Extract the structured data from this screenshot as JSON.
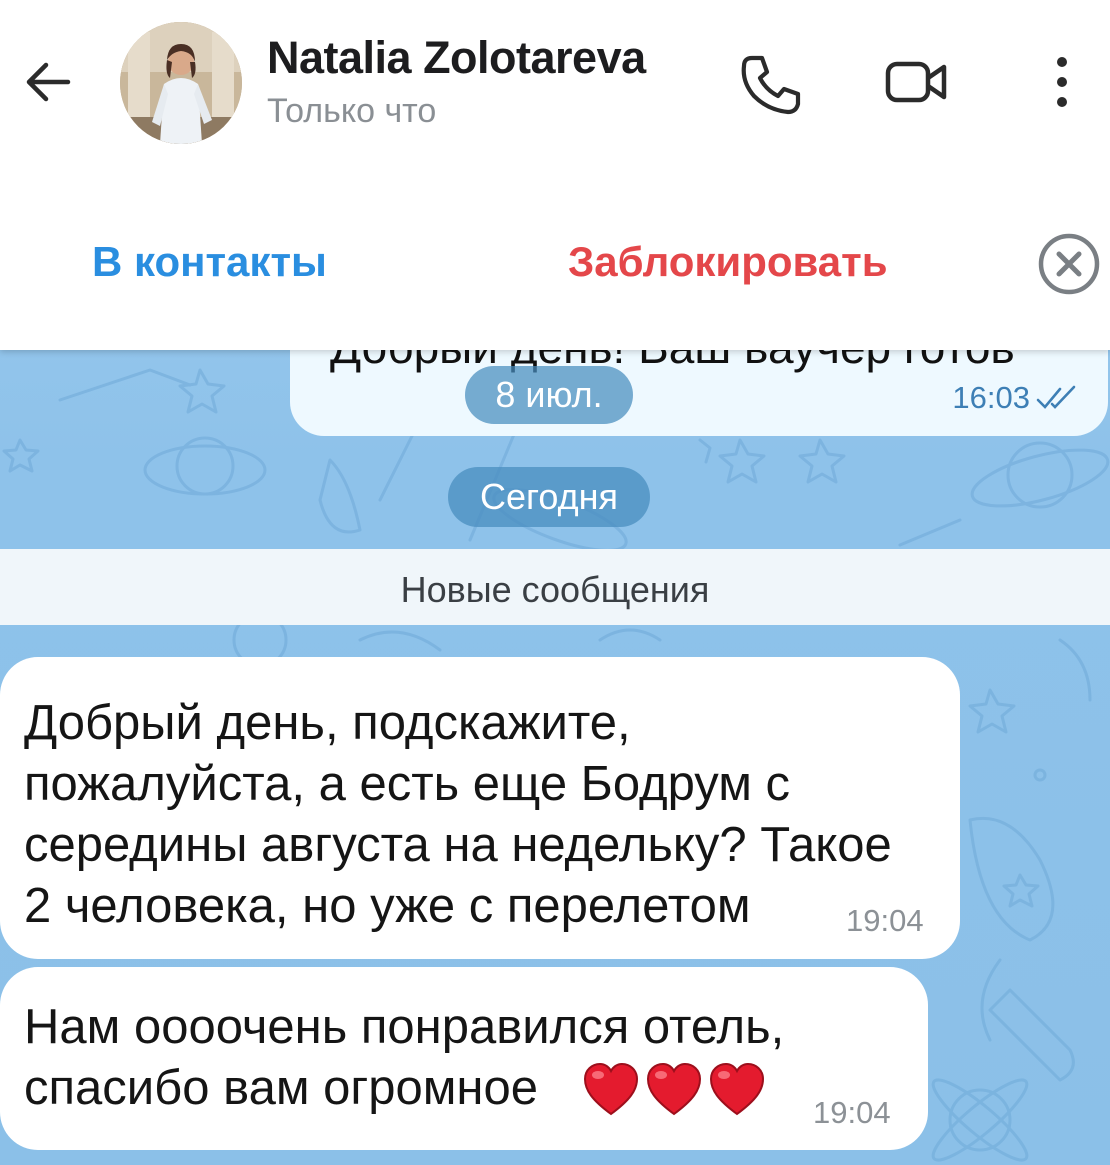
{
  "header": {
    "contact_name": "Natalia Zolotareva",
    "status": "Только что",
    "add_contact_label": "В контакты",
    "block_label": "Заблокировать"
  },
  "chat": {
    "previous_message": {
      "text_cut": "Добрый день! Ваш ваучер готов",
      "time": "16:03"
    },
    "date_old": "8 июл.",
    "date_today": "Сегодня",
    "new_messages_label": "Новые сообщения",
    "messages": [
      {
        "text": "Добрый день, подскажите,\nпожалуйста, а есть еще Бодрум с\nсередины августа на недельку? Такое\n2 человека, но уже с перелетом",
        "time": "19:04"
      },
      {
        "text": "Нам оооочень понравился отель,\nспасибо вам огромное",
        "time": "19:04"
      }
    ]
  },
  "colors": {
    "accent_blue": "#2a8ee0",
    "block_red": "#e4474a",
    "chat_background": "#8fc3ea",
    "heart_red": "#e41b2e"
  },
  "icons": [
    "back-arrow-icon",
    "phone-icon",
    "video-camera-icon",
    "more-vertical-icon",
    "close-circle-icon",
    "read-double-check-icon",
    "heart-icon"
  ]
}
